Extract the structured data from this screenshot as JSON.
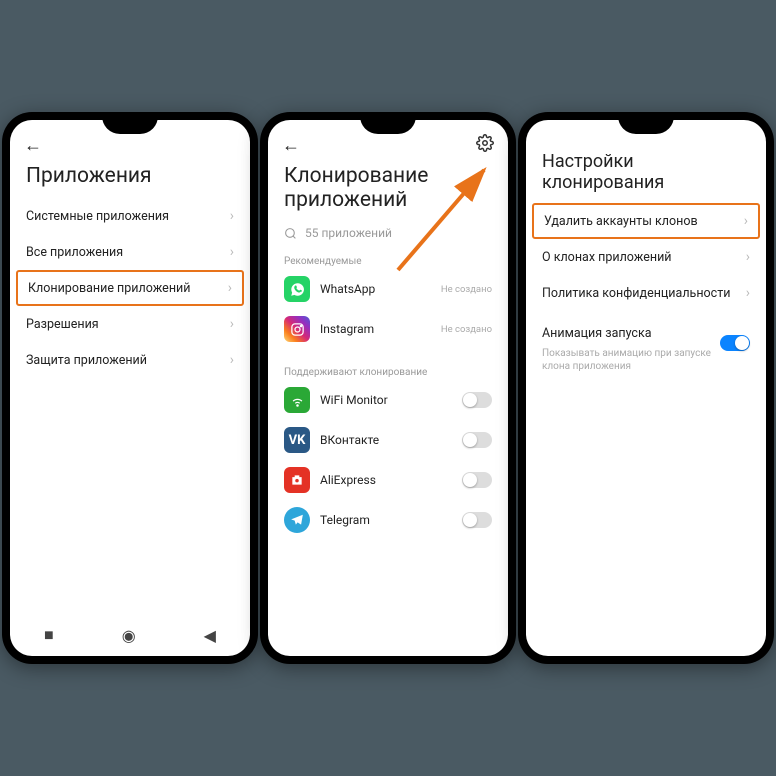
{
  "screen1": {
    "title": "Приложения",
    "items": [
      {
        "label": "Системные приложения"
      },
      {
        "label": "Все приложения"
      },
      {
        "label": "Клонирование приложений"
      },
      {
        "label": "Разрешения"
      },
      {
        "label": "Защита приложений"
      }
    ]
  },
  "screen2": {
    "title": "Клонирование приложений",
    "search_placeholder": "55 приложений",
    "section_recommended": "Рекомендуемые",
    "section_supported": "Поддерживают клонирование",
    "status_not_created": "Не создано",
    "apps_recommended": [
      {
        "name": "WhatsApp",
        "icon": "whatsapp-icon"
      },
      {
        "name": "Instagram",
        "icon": "instagram-icon"
      }
    ],
    "apps_supported": [
      {
        "name": "WiFi Monitor",
        "icon": "wifi-icon"
      },
      {
        "name": "ВКонтакте",
        "icon": "vk-icon"
      },
      {
        "name": "AliExpress",
        "icon": "aliexpress-icon"
      },
      {
        "name": "Telegram",
        "icon": "telegram-icon"
      }
    ]
  },
  "screen3": {
    "title": "Настройки клонирования",
    "items": [
      {
        "label": "Удалить аккаунты клонов"
      },
      {
        "label": "О клонах приложений"
      },
      {
        "label": "Политика конфиденциальности"
      }
    ],
    "anim_label": "Анимация запуска",
    "anim_desc": "Показывать анимацию при запуске клона приложения"
  }
}
